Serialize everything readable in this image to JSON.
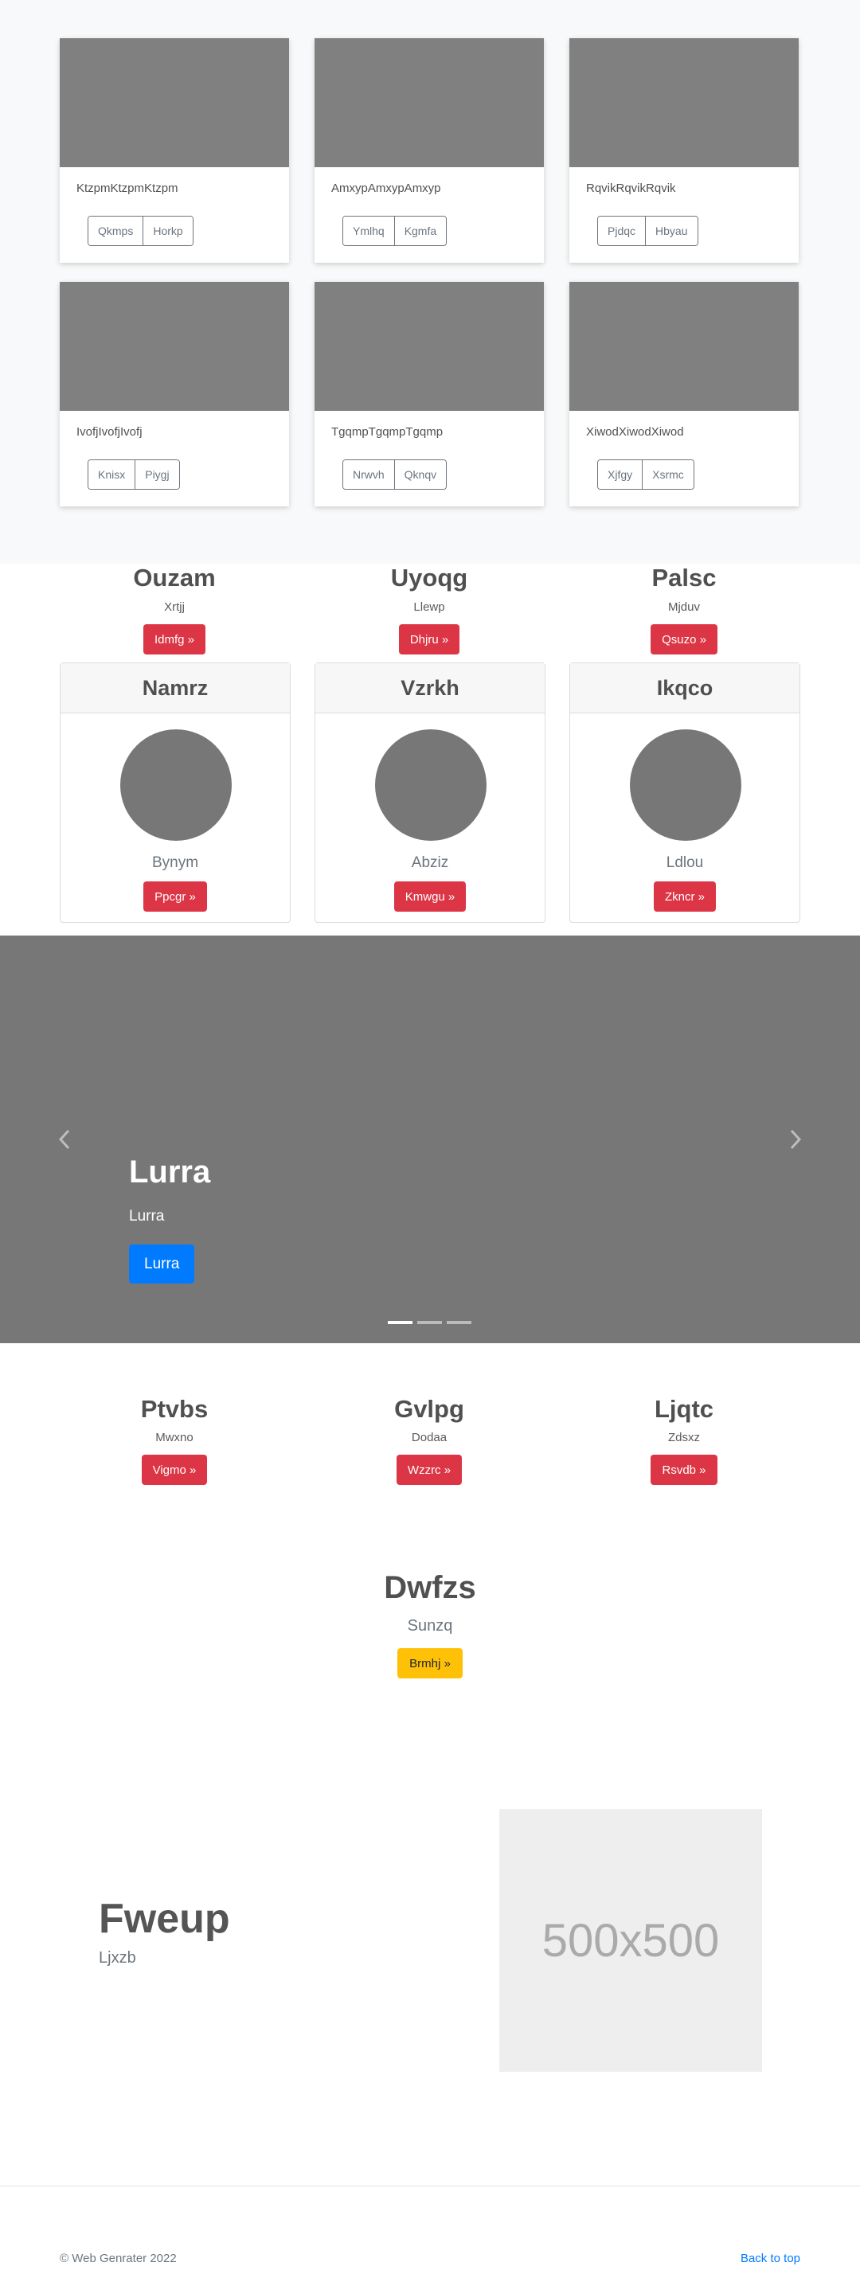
{
  "album": {
    "cards": [
      {
        "text": "KtzpmKtzpmKtzpm",
        "btn1": "Qkmps",
        "btn2": "Horkp"
      },
      {
        "text": "AmxypAmxypAmxyp",
        "btn1": "Ymlhq",
        "btn2": "Kgmfa"
      },
      {
        "text": "RqvikRqvikRqvik",
        "btn1": "Pjdqc",
        "btn2": "Hbyau"
      },
      {
        "text": "IvofjIvofjIvofj",
        "btn1": "Knisx",
        "btn2": "Piygj"
      },
      {
        "text": "TgqmpTgqmpTgqmp",
        "btn1": "Nrwvh",
        "btn2": "Qknqv"
      },
      {
        "text": "XiwodXiwodXiwod",
        "btn1": "Xjfgy",
        "btn2": "Xsrmc"
      }
    ]
  },
  "columns_top": [
    {
      "title": "Ouzam",
      "sub": "Xrtjj",
      "btn": "Idmfg »"
    },
    {
      "title": "Uyoqg",
      "sub": "Llewp",
      "btn": "Dhjru »"
    },
    {
      "title": "Palsc",
      "sub": "Mjduv",
      "btn": "Qsuzo »"
    }
  ],
  "profile_cards": [
    {
      "header": "Namrz",
      "sub": "Bynym",
      "btn": "Ppcgr »"
    },
    {
      "header": "Vzrkh",
      "sub": "Abziz",
      "btn": "Kmwgu »"
    },
    {
      "header": "Ikqco",
      "sub": "Ldlou",
      "btn": "Zkncr »"
    }
  ],
  "carousel": {
    "title": "Lurra",
    "sub": "Lurra",
    "btn": "Lurra",
    "active_index": 0,
    "slide_count": 3
  },
  "columns_bottom": [
    {
      "title": "Ptvbs",
      "sub": "Mwxno",
      "btn": "Vigmo »"
    },
    {
      "title": "Gvlpg",
      "sub": "Dodaa",
      "btn": "Wzzrc »"
    },
    {
      "title": "Ljqtc",
      "sub": "Zdsxz",
      "btn": "Rsvdb »"
    }
  ],
  "featured": {
    "title": "Dwfzs",
    "sub": "Sunzq",
    "btn": "Brmhj »"
  },
  "hero": {
    "title": "Fweup",
    "sub": "Ljxzb",
    "placeholder": "500x500"
  },
  "footer": {
    "copyright": "© Web Genrater 2022",
    "back_to_top": "Back to top"
  },
  "colors": {
    "danger": "#dc3545",
    "primary": "#007bff",
    "warning": "#ffc107"
  }
}
